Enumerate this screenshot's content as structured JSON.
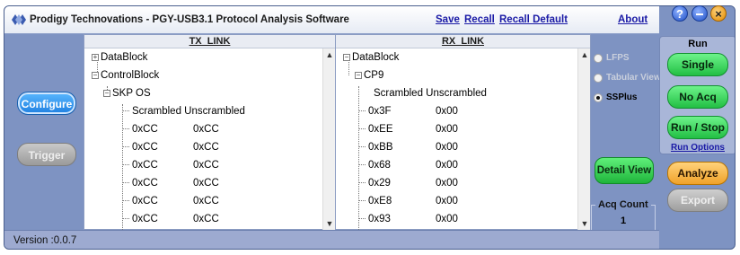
{
  "window": {
    "title": "Prodigy Technovations - PGY-USB3.1 Protocol Analysis Software"
  },
  "header_links": {
    "save": "Save",
    "recall": "Recall",
    "recall_default": "Recall Default",
    "about": "About"
  },
  "window_controls": {
    "help": "?",
    "close": "×"
  },
  "nav": {
    "configure": "Configure",
    "trigger": "Trigger"
  },
  "tx_panel": {
    "title": "TX_LINK",
    "rows": [
      {
        "kind": "collapsed",
        "label": "DataBlock"
      },
      {
        "kind": "expanded",
        "label": "ControlBlock"
      },
      {
        "kind": "expanded",
        "label": "SKP OS"
      },
      {
        "kind": "header",
        "col1": "Scrambled",
        "col2": "Unscrambled"
      },
      {
        "kind": "pair",
        "col1": "0xCC",
        "col2": "0xCC"
      },
      {
        "kind": "pair",
        "col1": "0xCC",
        "col2": "0xCC"
      },
      {
        "kind": "pair",
        "col1": "0xCC",
        "col2": "0xCC"
      },
      {
        "kind": "pair",
        "col1": "0xCC",
        "col2": "0xCC"
      },
      {
        "kind": "pair",
        "col1": "0xCC",
        "col2": "0xCC"
      },
      {
        "kind": "pair",
        "col1": "0xCC",
        "col2": "0xCC"
      }
    ]
  },
  "rx_panel": {
    "title": "RX_LINK",
    "rows": [
      {
        "kind": "expanded",
        "label": "DataBlock"
      },
      {
        "kind": "expanded",
        "label": "CP9"
      },
      {
        "kind": "header",
        "col1": "Scrambled",
        "col2": "Unscrambled"
      },
      {
        "kind": "pair",
        "col1": "0x3F",
        "col2": "0x00"
      },
      {
        "kind": "pair",
        "col1": "0xEE",
        "col2": "0x00"
      },
      {
        "kind": "pair",
        "col1": "0xBB",
        "col2": "0x00"
      },
      {
        "kind": "pair",
        "col1": "0x68",
        "col2": "0x00"
      },
      {
        "kind": "pair",
        "col1": "0x29",
        "col2": "0x00"
      },
      {
        "kind": "pair",
        "col1": "0xE8",
        "col2": "0x00"
      },
      {
        "kind": "pair",
        "col1": "0x93",
        "col2": "0x00"
      }
    ]
  },
  "view_options": {
    "options": [
      {
        "label": "LFPS",
        "selected": false,
        "enabled": false
      },
      {
        "label": "Tabular View",
        "selected": false,
        "enabled": false
      },
      {
        "label": "SSPlus",
        "selected": true,
        "enabled": true
      }
    ],
    "detail_view": "Detail View"
  },
  "acquisition": {
    "label": "Acq Count",
    "value": "1"
  },
  "run_panel": {
    "title": "Run",
    "single": "Single",
    "no_acq": "No Acq",
    "run_stop": "Run / Stop",
    "run_options": "Run Options"
  },
  "actions": {
    "analyze": "Analyze",
    "export": "Export"
  },
  "status": {
    "version": "Version :0.0.7"
  },
  "colors": {
    "frame": "#7e93c2",
    "green_button": "#22bf44",
    "analyze_button": "#f0a22a",
    "link": "#1a1aa6"
  }
}
